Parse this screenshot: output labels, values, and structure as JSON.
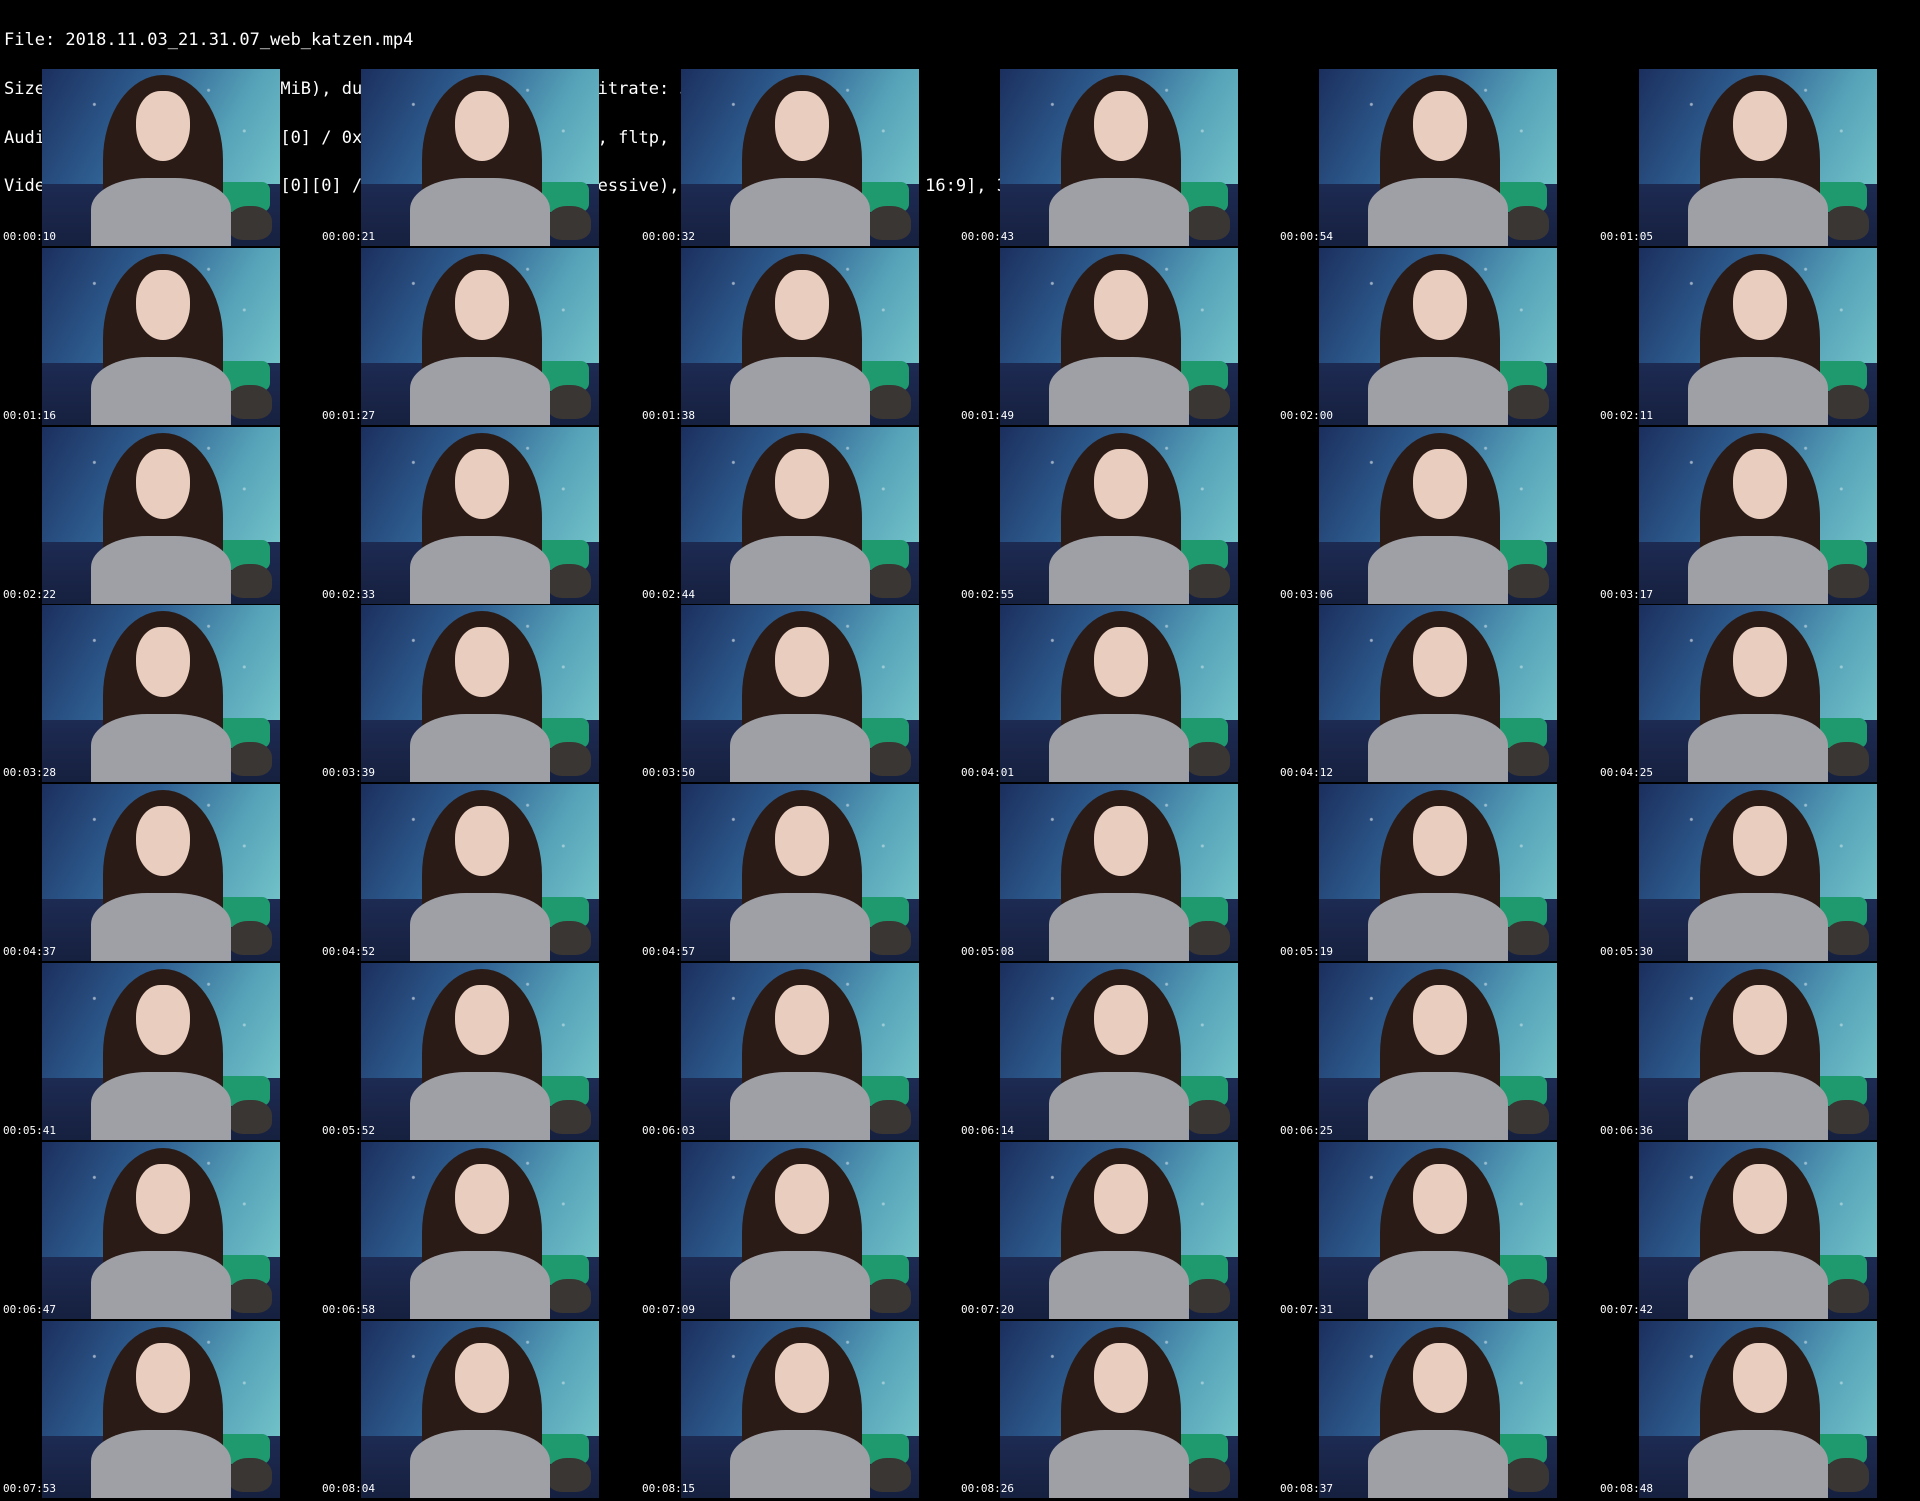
{
  "header": {
    "lines": [
      "File: 2018.11.03_21.31.07_web_katzen.mp4",
      "Size: 373079608 bytes (356 MiB), duration: 00:09:45, avg.bitrate: 5102 kb/s",
      "Audio: aac (LC) ([15][0][0][0] / 0x000F), 44100 Hz, stereo, fltp, 131 kb/s",
      "Video: h264 (High) ([27][0][0][0] / 0x001B), yuv420p(progressive), 1920x1080 [SAR 1:1 DAR 16:9], 30.00 fps(r)"
    ]
  },
  "thumbnails": [
    "00:00:10",
    "00:00:21",
    "00:00:32",
    "00:00:43",
    "00:00:54",
    "00:01:05",
    "00:01:16",
    "00:01:27",
    "00:01:38",
    "00:01:49",
    "00:02:00",
    "00:02:11",
    "00:02:22",
    "00:02:33",
    "00:02:44",
    "00:02:55",
    "00:03:06",
    "00:03:17",
    "00:03:28",
    "00:03:39",
    "00:03:50",
    "00:04:01",
    "00:04:12",
    "00:04:25",
    "00:04:37",
    "00:04:52",
    "00:04:57",
    "00:05:08",
    "00:05:19",
    "00:05:30",
    "00:05:41",
    "00:05:52",
    "00:06:03",
    "00:06:14",
    "00:06:25",
    "00:06:36",
    "00:06:47",
    "00:06:58",
    "00:07:09",
    "00:07:20",
    "00:07:31",
    "00:07:42",
    "00:07:53",
    "00:08:04",
    "00:08:15",
    "00:08:26",
    "00:08:37",
    "00:08:48"
  ]
}
